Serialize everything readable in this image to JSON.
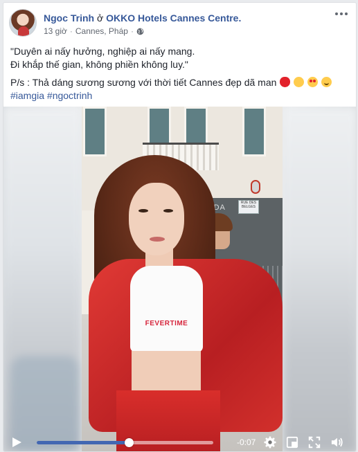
{
  "post": {
    "author": "Ngoc Trinh",
    "at_text": "ở",
    "place": "OKKO Hotels Cannes Centre.",
    "time": "13 giờ",
    "separator": "·",
    "location": "Cannes, Pháp",
    "privacy_icon": "globe-icon",
    "menu_icon": "more-options-icon",
    "text_lines": [
      "\"Duyên ai nấy hưởng, nghiệp ai nấy mang.",
      "Đi khắp thế gian, không phiền không luy.\""
    ],
    "ps_text": "P/s : Thả dáng sương sương với thời tiết Cannes đẹp dã man",
    "emojis": [
      "kiss-mark",
      "face-blowing-kiss",
      "heart-eyes",
      "smiling-blush"
    ],
    "hashtags": "#iamgia #ngoctrinh"
  },
  "video": {
    "shirt_text": "FEVERTIME",
    "shop_sign": "PRADA",
    "street_sign": "RUE DES BELGES",
    "progress": 0.52,
    "time_remaining": "-0:07",
    "icons": [
      "play-icon",
      "gear-icon",
      "window-icon",
      "fullscreen-icon",
      "volume-icon"
    ],
    "accent": "#4267b2"
  },
  "colors": {
    "link": "#365899",
    "text": "#1d2129",
    "meta": "#616770"
  }
}
